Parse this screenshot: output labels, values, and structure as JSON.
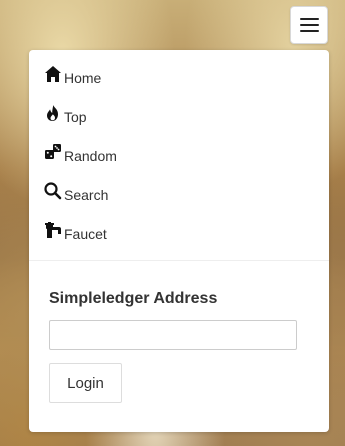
{
  "nav": {
    "items": [
      {
        "label": "Home",
        "icon": "home-icon"
      },
      {
        "label": "Top",
        "icon": "flame-icon"
      },
      {
        "label": "Random",
        "icon": "dice-icon"
      },
      {
        "label": "Search",
        "icon": "search-icon"
      },
      {
        "label": "Faucet",
        "icon": "faucet-icon"
      }
    ]
  },
  "login": {
    "label": "Simpleledger Address",
    "address_value": "",
    "address_placeholder": "",
    "button_label": "Login"
  },
  "toggle": {
    "icon": "hamburger-menu-icon"
  }
}
